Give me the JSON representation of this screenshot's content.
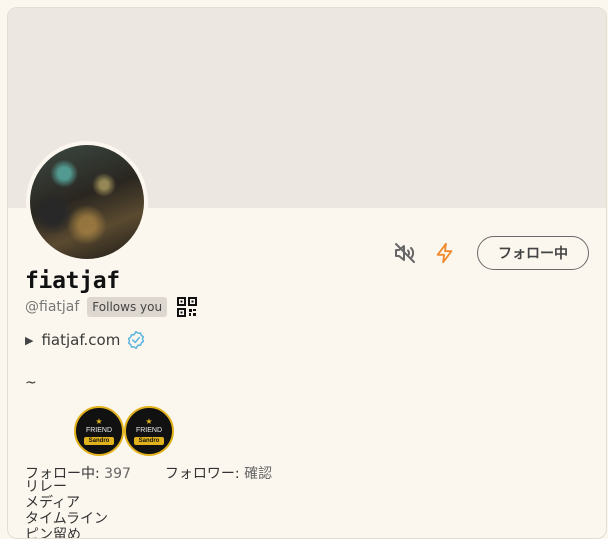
{
  "profile": {
    "display_name": "fiatjaf",
    "handle": "@fiatjaf",
    "follows_you": "Follows you",
    "website": "fiatjaf.com",
    "bio": "~"
  },
  "actions": {
    "follow_label": "フォロー中",
    "mute_icon": "speaker-muted-icon",
    "zap_icon": "lightning-icon"
  },
  "badges": [
    {
      "title": "FRIEND",
      "ribbon": "Sandro"
    },
    {
      "title": "FRIEND",
      "ribbon": "Sandro"
    }
  ],
  "stats": {
    "following_label": "フォロー中:",
    "following_count": "397",
    "followers_label": "フォロワー:",
    "followers_value": "確認"
  },
  "tabs": [
    "リレー",
    "メディア",
    "タイムライン",
    "ピン留め"
  ],
  "colors": {
    "banner": "#ece7e1",
    "background": "#fbf7ef",
    "zap": "#f08a2e",
    "verified": "#5cb4e0",
    "badge_gold": "#e1b21d"
  }
}
